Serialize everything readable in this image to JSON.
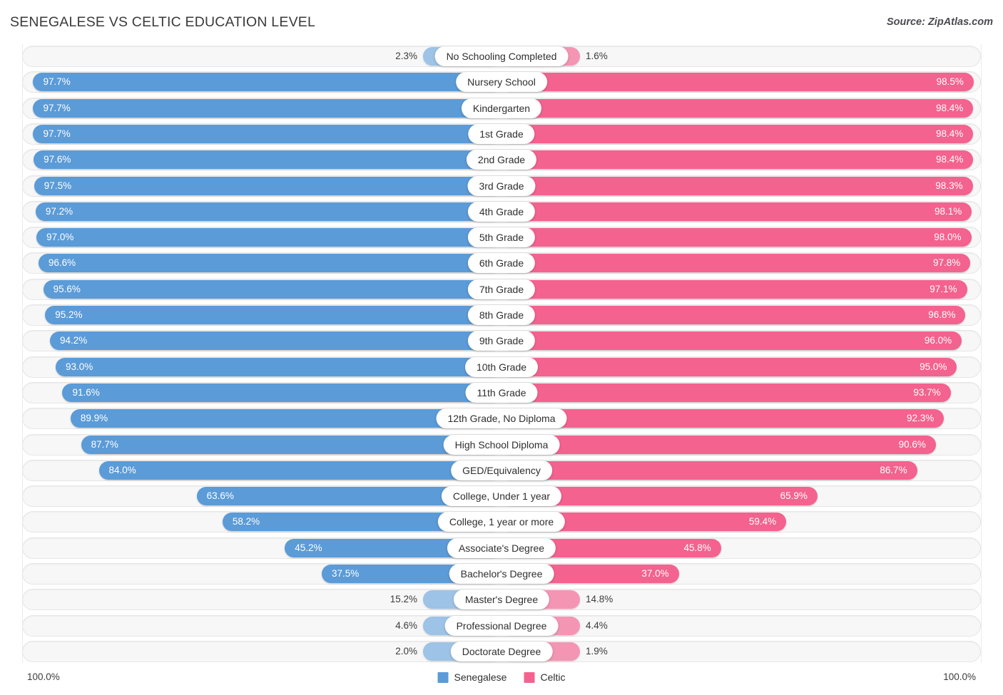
{
  "header": {
    "title": "SENEGALESE VS CELTIC EDUCATION LEVEL",
    "source": "Source: ZipAtlas.com"
  },
  "footer": {
    "axis_left": "100.0%",
    "axis_right": "100.0%",
    "legend": [
      {
        "label": "Senegalese",
        "color": "#5b9bd8"
      },
      {
        "label": "Celtic",
        "color": "#f4628f"
      }
    ]
  },
  "colors": {
    "senegalese": "#5b9bd8",
    "senegalese_light": "#9dc3e6",
    "celtic": "#f4628f",
    "celtic_light": "#f495b4",
    "track": "#f7f7f7",
    "track_border": "#e6e6e6"
  },
  "chart_data": {
    "type": "bar",
    "orientation": "horizontal-diverging",
    "title": "SENEGALESE VS CELTIC EDUCATION LEVEL",
    "xlabel": "",
    "ylabel": "",
    "xlim": [
      0,
      100
    ],
    "grid": false,
    "legend_position": "bottom-center",
    "categories": [
      "No Schooling Completed",
      "Nursery School",
      "Kindergarten",
      "1st Grade",
      "2nd Grade",
      "3rd Grade",
      "4th Grade",
      "5th Grade",
      "6th Grade",
      "7th Grade",
      "8th Grade",
      "9th Grade",
      "10th Grade",
      "11th Grade",
      "12th Grade, No Diploma",
      "High School Diploma",
      "GED/Equivalency",
      "College, Under 1 year",
      "College, 1 year or more",
      "Associate's Degree",
      "Bachelor's Degree",
      "Master's Degree",
      "Professional Degree",
      "Doctorate Degree"
    ],
    "series": [
      {
        "name": "Senegalese",
        "color": "#5b9bd8",
        "values": [
          2.3,
          97.7,
          97.7,
          97.7,
          97.6,
          97.5,
          97.2,
          97.0,
          96.6,
          95.6,
          95.2,
          94.2,
          93.0,
          91.6,
          89.9,
          87.7,
          84.0,
          63.6,
          58.2,
          45.2,
          37.5,
          15.2,
          4.6,
          2.0
        ],
        "labels": [
          "2.3%",
          "97.7%",
          "97.7%",
          "97.7%",
          "97.6%",
          "97.5%",
          "97.2%",
          "97.0%",
          "96.6%",
          "95.6%",
          "95.2%",
          "94.2%",
          "93.0%",
          "91.6%",
          "89.9%",
          "87.7%",
          "84.0%",
          "63.6%",
          "58.2%",
          "45.2%",
          "37.5%",
          "15.2%",
          "4.6%",
          "2.0%"
        ]
      },
      {
        "name": "Celtic",
        "color": "#f4628f",
        "values": [
          1.6,
          98.5,
          98.4,
          98.4,
          98.4,
          98.3,
          98.1,
          98.0,
          97.8,
          97.1,
          96.8,
          96.0,
          95.0,
          93.7,
          92.3,
          90.6,
          86.7,
          65.9,
          59.4,
          45.8,
          37.0,
          14.8,
          4.4,
          1.9
        ],
        "labels": [
          "1.6%",
          "98.5%",
          "98.4%",
          "98.4%",
          "98.4%",
          "98.3%",
          "98.1%",
          "98.0%",
          "97.8%",
          "97.1%",
          "96.8%",
          "96.0%",
          "95.0%",
          "93.7%",
          "92.3%",
          "90.6%",
          "86.7%",
          "65.9%",
          "59.4%",
          "45.8%",
          "37.0%",
          "14.8%",
          "4.4%",
          "1.9%"
        ]
      }
    ]
  }
}
